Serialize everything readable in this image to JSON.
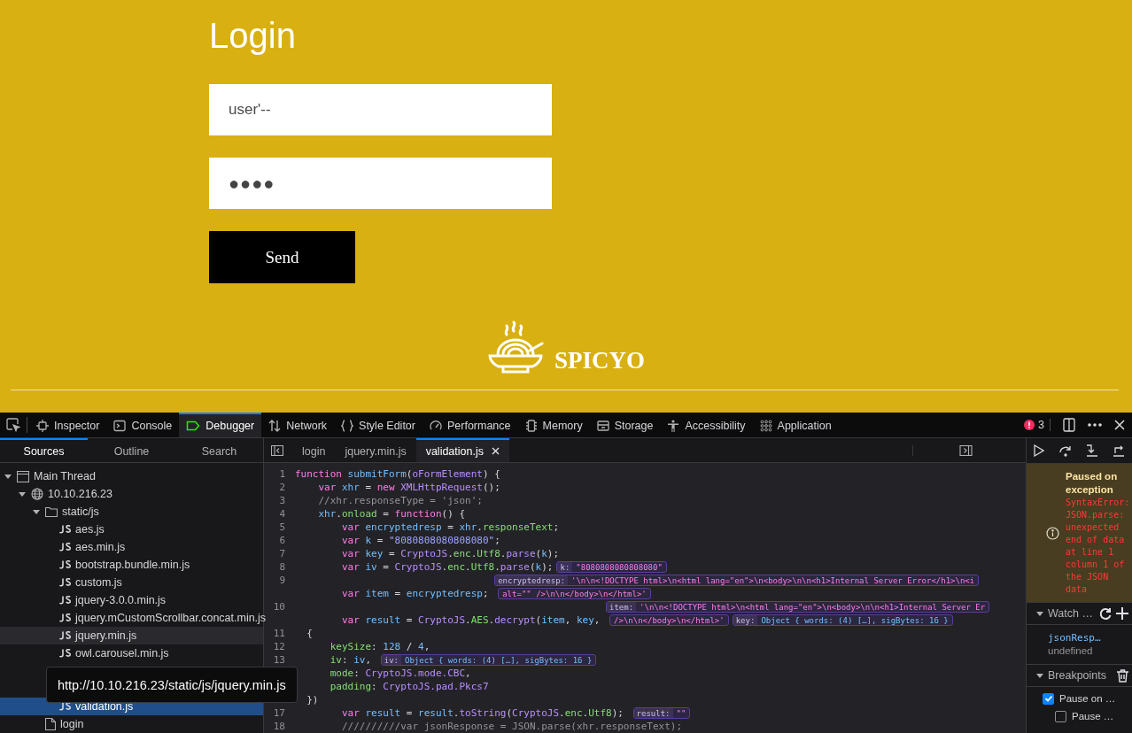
{
  "page": {
    "title": "Login",
    "username": {
      "value": "user'--"
    },
    "password": {
      "value": "●●●●"
    },
    "submit": "Send",
    "brand": "SPICYO"
  },
  "devtools": {
    "tools": [
      {
        "kind": "inspector",
        "label": "Inspector",
        "selected": false
      },
      {
        "kind": "console",
        "label": "Console",
        "selected": false
      },
      {
        "kind": "debugger",
        "label": "Debugger",
        "selected": true
      },
      {
        "kind": "network",
        "label": "Network",
        "selected": false
      },
      {
        "kind": "style",
        "label": "Style Editor",
        "selected": false
      },
      {
        "kind": "performance",
        "label": "Performance",
        "selected": false
      },
      {
        "kind": "memory",
        "label": "Memory",
        "selected": false
      },
      {
        "kind": "storage",
        "label": "Storage",
        "selected": false
      },
      {
        "kind": "accessibility",
        "label": "Accessibility",
        "selected": false
      },
      {
        "kind": "application",
        "label": "Application",
        "selected": false
      }
    ],
    "error_count": "3",
    "sidebar_tabs": [
      {
        "label": "Sources",
        "selected": true
      },
      {
        "label": "Outline",
        "selected": false
      },
      {
        "label": "Search",
        "selected": false
      }
    ],
    "tree": [
      {
        "kind": "thread",
        "label": "Main Thread",
        "expanded": true,
        "children": [
          {
            "kind": "domain",
            "label": "10.10.216.23",
            "expanded": true,
            "children": [
              {
                "kind": "folder",
                "label": "static/js",
                "expanded": true,
                "children": [
                  {
                    "kind": "js",
                    "label": "aes.js",
                    "selected": false,
                    "hovered": false
                  },
                  {
                    "kind": "js",
                    "label": "aes.min.js",
                    "selected": false,
                    "hovered": false
                  },
                  {
                    "kind": "js",
                    "label": "bootstrap.bundle.min.js",
                    "selected": false,
                    "hovered": false
                  },
                  {
                    "kind": "js",
                    "label": "custom.js",
                    "selected": false,
                    "hovered": false
                  },
                  {
                    "kind": "js",
                    "label": "jquery-3.0.0.min.js",
                    "selected": false,
                    "hovered": false
                  },
                  {
                    "kind": "js",
                    "label": "jquery.mCustomScrollbar.concat.min.js",
                    "selected": false,
                    "hovered": false
                  },
                  {
                    "kind": "js",
                    "label": "jquery.min.js",
                    "selected": false,
                    "hovered": true
                  },
                  {
                    "kind": "js",
                    "label": "owl.carousel.min.js",
                    "selected": false,
                    "hovered": false
                  },
                  {
                    "kind": "tooltip",
                    "text": "http://10.10.216.23/static/js/jquery.min.js"
                  },
                  {
                    "kind": "js",
                    "label": "validation.js",
                    "selected": true,
                    "hovered": false
                  }
                ]
              },
              {
                "kind": "file",
                "label": "login",
                "selected": false,
                "hovered": false
              }
            ]
          }
        ]
      }
    ],
    "editor_tabs": [
      {
        "label": "login",
        "selected": false,
        "closable": false
      },
      {
        "label": "jquery.min.js",
        "selected": false,
        "closable": false
      },
      {
        "label": "validation.js",
        "selected": true,
        "closable": true
      }
    ],
    "code_rows": [
      {
        "number": "1",
        "tokens": [
          {
            "kind": "keyword",
            "text": "function"
          },
          {
            "kind": "identifier",
            "text": " submitForm"
          },
          {
            "kind": "plain",
            "text": "("
          },
          {
            "kind": "function",
            "text": "oFormElement"
          },
          {
            "kind": "plain",
            "text": ") {"
          }
        ]
      },
      {
        "number": "2",
        "tokens": [
          {
            "kind": "keyword",
            "text": "    var"
          },
          {
            "kind": "identifier",
            "text": " xhr"
          },
          {
            "kind": "plain",
            "text": " = "
          },
          {
            "kind": "keyword",
            "text": "new"
          },
          {
            "kind": "function",
            "text": " XMLHttpRequest"
          },
          {
            "kind": "plain",
            "text": "();"
          }
        ]
      },
      {
        "number": "3",
        "tokens": [
          {
            "kind": "comment",
            "text": "    //xhr.responseType = 'json';"
          }
        ]
      },
      {
        "number": "4",
        "tokens": [
          {
            "kind": "identifier",
            "text": "    xhr"
          },
          {
            "kind": "plain",
            "text": "."
          },
          {
            "kind": "property",
            "text": "onload"
          },
          {
            "kind": "plain",
            "text": " = "
          },
          {
            "kind": "keyword",
            "text": "function"
          },
          {
            "kind": "plain",
            "text": "() {"
          }
        ]
      },
      {
        "number": "5",
        "tokens": [
          {
            "kind": "keyword",
            "text": "        var"
          },
          {
            "kind": "identifier",
            "text": " encryptedresp"
          },
          {
            "kind": "plain",
            "text": " = "
          },
          {
            "kind": "identifier",
            "text": "xhr"
          },
          {
            "kind": "plain",
            "text": "."
          },
          {
            "kind": "property",
            "text": "responseText"
          },
          {
            "kind": "plain",
            "text": ";"
          }
        ]
      },
      {
        "number": "6",
        "tokens": [
          {
            "kind": "keyword",
            "text": "        var"
          },
          {
            "kind": "identifier",
            "text": " k"
          },
          {
            "kind": "plain",
            "text": " = "
          },
          {
            "kind": "string",
            "text": "\"8080808080808080\""
          },
          {
            "kind": "plain",
            "text": ";"
          }
        ]
      },
      {
        "number": "7",
        "tokens": [
          {
            "kind": "keyword",
            "text": "        var"
          },
          {
            "kind": "identifier",
            "text": " key"
          },
          {
            "kind": "plain",
            "text": " = "
          },
          {
            "kind": "function",
            "text": "CryptoJS"
          },
          {
            "kind": "plain",
            "text": "."
          },
          {
            "kind": "property",
            "text": "enc"
          },
          {
            "kind": "plain",
            "text": "."
          },
          {
            "kind": "property",
            "text": "Utf8"
          },
          {
            "kind": "plain",
            "text": "."
          },
          {
            "kind": "function",
            "text": "parse"
          },
          {
            "kind": "plain",
            "text": "("
          },
          {
            "kind": "identifier",
            "text": "k"
          },
          {
            "kind": "plain",
            "text": ");"
          }
        ]
      },
      {
        "number": "8",
        "tokens": [
          {
            "kind": "keyword",
            "text": "        var"
          },
          {
            "kind": "identifier",
            "text": " iv"
          },
          {
            "kind": "plain",
            "text": " = "
          },
          {
            "kind": "function",
            "text": "CryptoJS"
          },
          {
            "kind": "plain",
            "text": "."
          },
          {
            "kind": "property",
            "text": "enc"
          },
          {
            "kind": "plain",
            "text": "."
          },
          {
            "kind": "property",
            "text": "Utf8"
          },
          {
            "kind": "plain",
            "text": "."
          },
          {
            "kind": "function",
            "text": "parse"
          },
          {
            "kind": "plain",
            "text": "("
          },
          {
            "kind": "identifier",
            "text": "k"
          },
          {
            "kind": "plain",
            "text": ");"
          }
        ],
        "previews": [
          {
            "label": "k:",
            "value": "\"8080808080808080\"",
            "kind": "string"
          }
        ]
      },
      {
        "number": "9",
        "previews": [
          {
            "label": "encryptedresp:",
            "value": "'\\n\\n<!DOCTYPE html>\\n<html lang=\"en\">\\n<body>\\n\\n<h1>Internal Server Error</h1>\\n<i",
            "kind": "string"
          }
        ]
      },
      {
        "tokens": [
          {
            "kind": "keyword",
            "text": "        var"
          },
          {
            "kind": "identifier",
            "text": " item"
          },
          {
            "kind": "plain",
            "text": " = "
          },
          {
            "kind": "identifier",
            "text": "encryptedresp"
          },
          {
            "kind": "plain",
            "text": "; "
          }
        ],
        "previews": [
          {
            "value": "alt=\"\" />\\n\\n</body>\\n</html>'",
            "kind": "string"
          }
        ]
      },
      {
        "number": "10",
        "previews": [
          {
            "label": "item:",
            "value": "'\\n\\n<!DOCTYPE html>\\n<html lang=\"en\">\\n<body>\\n\\n<h1>Internal Server Er",
            "kind": "string"
          }
        ]
      },
      {
        "tokens": [
          {
            "kind": "keyword",
            "text": "        var"
          },
          {
            "kind": "identifier",
            "text": " result"
          },
          {
            "kind": "plain",
            "text": " = "
          },
          {
            "kind": "function",
            "text": "CryptoJS"
          },
          {
            "kind": "plain",
            "text": "."
          },
          {
            "kind": "property",
            "text": "AES"
          },
          {
            "kind": "plain",
            "text": "."
          },
          {
            "kind": "function",
            "text": "decrypt"
          },
          {
            "kind": "plain",
            "text": "("
          },
          {
            "kind": "identifier",
            "text": "item"
          },
          {
            "kind": "plain",
            "text": ", "
          },
          {
            "kind": "identifier",
            "text": "key"
          },
          {
            "kind": "plain",
            "text": ", "
          }
        ],
        "previews": [
          {
            "value": "/>\\n\\n</body>\\n</html>'",
            "kind": "string"
          },
          {
            "label": "key:",
            "value": "Object { words: (4) […], sigBytes: 16 }",
            "kind": "object"
          }
        ]
      },
      {
        "number": "11",
        "tokens": [
          {
            "kind": "plain",
            "text": "  {"
          }
        ]
      },
      {
        "number": "12",
        "tokens": [
          {
            "kind": "property",
            "text": "      keySize"
          },
          {
            "kind": "plain",
            "text": ": "
          },
          {
            "kind": "number",
            "text": "128"
          },
          {
            "kind": "plain",
            "text": " / "
          },
          {
            "kind": "number",
            "text": "4"
          },
          {
            "kind": "plain",
            "text": ","
          }
        ]
      },
      {
        "number": "13",
        "tokens": [
          {
            "kind": "property",
            "text": "      iv"
          },
          {
            "kind": "plain",
            "text": ": "
          },
          {
            "kind": "identifier",
            "text": "iv"
          },
          {
            "kind": "plain",
            "text": ", "
          }
        ],
        "previews": [
          {
            "label": "iv:",
            "value": "Object { words: (4) […], sigBytes: 16 }",
            "kind": "object"
          }
        ]
      },
      {
        "tokens": [
          {
            "kind": "property",
            "text": "      mode"
          },
          {
            "kind": "plain",
            "text": ": "
          },
          {
            "kind": "function",
            "text": "CryptoJS.mode.CBC"
          },
          {
            "kind": "plain",
            "text": ","
          }
        ]
      },
      {
        "tokens": [
          {
            "kind": "property",
            "text": "      padding"
          },
          {
            "kind": "plain",
            "text": ": "
          },
          {
            "kind": "function",
            "text": "CryptoJS.pad.Pkcs7"
          }
        ]
      },
      {
        "tokens": [
          {
            "kind": "plain",
            "text": "  })"
          }
        ]
      },
      {
        "number": "17",
        "tokens": [
          {
            "kind": "keyword",
            "text": "        var"
          },
          {
            "kind": "identifier",
            "text": " result"
          },
          {
            "kind": "plain",
            "text": " = "
          },
          {
            "kind": "identifier",
            "text": "result"
          },
          {
            "kind": "plain",
            "text": "."
          },
          {
            "kind": "function",
            "text": "toString"
          },
          {
            "kind": "plain",
            "text": "("
          },
          {
            "kind": "function",
            "text": "CryptoJS"
          },
          {
            "kind": "plain",
            "text": "."
          },
          {
            "kind": "property",
            "text": "enc"
          },
          {
            "kind": "plain",
            "text": "."
          },
          {
            "kind": "property",
            "text": "Utf8"
          },
          {
            "kind": "plain",
            "text": "); "
          }
        ],
        "previews": [
          {
            "label": "result:",
            "value": "\"\"",
            "kind": "string"
          }
        ]
      },
      {
        "number": "18",
        "tokens": [
          {
            "kind": "comment",
            "text": "        //////////var jsonResponse = JSON.parse(xhr.responseText);"
          }
        ]
      }
    ],
    "pause": {
      "title": "Paused on exception",
      "message": "SyntaxError: JSON.parse: unexpected end of data at line 1 column 1 of the JSON data"
    },
    "watch": {
      "title": "Watch …",
      "expanded": true,
      "items": [
        {
          "name": "jsonResp…",
          "value": "undefined"
        }
      ]
    },
    "breakpoints": {
      "title": "Breakpoints",
      "expanded": true,
      "options": [
        {
          "label": "Pause on …",
          "checked": true,
          "children": [
            {
              "label": "Pause …",
              "checked": false
            }
          ]
        }
      ]
    }
  }
}
